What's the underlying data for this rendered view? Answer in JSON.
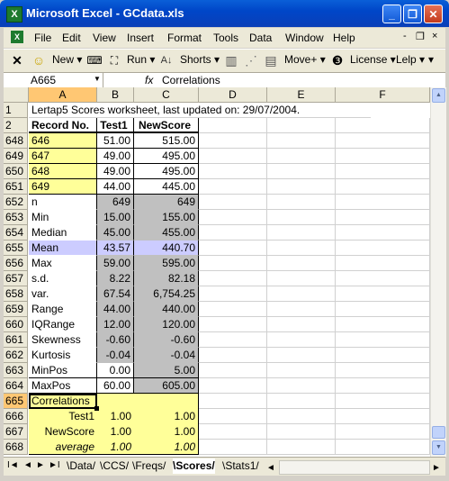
{
  "window": {
    "title": "Microsoft Excel - GCdata.xls",
    "app_icon": "X",
    "buttons": [
      "_",
      "❐",
      "✕"
    ]
  },
  "menubar": {
    "items": [
      "File",
      "Edit",
      "View",
      "Insert",
      "Format",
      "Tools",
      "Data",
      "Window",
      "Help"
    ],
    "controls": [
      "-",
      "❐",
      "×"
    ]
  },
  "toolbar": {
    "new_label": "New",
    "run_label": "Run",
    "shorts_label": "Shorts",
    "movep_label": "Move+",
    "license_label": "License",
    "help_label": "Lelp"
  },
  "formula_bar": {
    "name_box": "A665",
    "fx": "fx",
    "value": "Correlations"
  },
  "columns": [
    "A",
    "B",
    "C",
    "D",
    "E",
    "F"
  ],
  "rows": [
    {
      "num": "1",
      "cells": [
        "Lertap5 Scores worksheet, last updated on: 29/07/2004.",
        "",
        ""
      ],
      "style": "title"
    },
    {
      "num": "2",
      "cells": [
        "Record No.",
        "Test1",
        "NewScore"
      ],
      "style": "header"
    },
    {
      "num": "648",
      "cells": [
        "646",
        "51.00",
        "515.00"
      ],
      "style": "record"
    },
    {
      "num": "649",
      "cells": [
        "647",
        "49.00",
        "495.00"
      ],
      "style": "record"
    },
    {
      "num": "650",
      "cells": [
        "648",
        "49.00",
        "495.00"
      ],
      "style": "record"
    },
    {
      "num": "651",
      "cells": [
        "649",
        "44.00",
        "445.00"
      ],
      "style": "record"
    },
    {
      "num": "652",
      "cells": [
        "n",
        "649",
        "649"
      ],
      "style": "stat"
    },
    {
      "num": "653",
      "cells": [
        "Min",
        "15.00",
        "155.00"
      ],
      "style": "stat"
    },
    {
      "num": "654",
      "cells": [
        "Median",
        "45.00",
        "455.00"
      ],
      "style": "stat"
    },
    {
      "num": "655",
      "cells": [
        "Mean",
        "43.57",
        "440.70"
      ],
      "style": "mean"
    },
    {
      "num": "656",
      "cells": [
        "Max",
        "59.00",
        "595.00"
      ],
      "style": "stat"
    },
    {
      "num": "657",
      "cells": [
        "s.d.",
        "8.22",
        "82.18"
      ],
      "style": "stat"
    },
    {
      "num": "658",
      "cells": [
        "var.",
        "67.54",
        "6,754.25"
      ],
      "style": "stat"
    },
    {
      "num": "659",
      "cells": [
        "Range",
        "44.00",
        "440.00"
      ],
      "style": "stat"
    },
    {
      "num": "660",
      "cells": [
        "IQRange",
        "12.00",
        "120.00"
      ],
      "style": "stat"
    },
    {
      "num": "661",
      "cells": [
        "Skewness",
        "-0.60",
        "-0.60"
      ],
      "style": "stat"
    },
    {
      "num": "662",
      "cells": [
        "Kurtosis",
        "-0.04",
        "-0.04"
      ],
      "style": "stat"
    },
    {
      "num": "663",
      "cells": [
        "MinPos",
        "0.00",
        "5.00"
      ],
      "style": "pos"
    },
    {
      "num": "664",
      "cells": [
        "MaxPos",
        "60.00",
        "605.00"
      ],
      "style": "pos"
    },
    {
      "num": "665",
      "cells": [
        "Correlations",
        "",
        ""
      ],
      "style": "corrhead"
    },
    {
      "num": "666",
      "cells": [
        "Test1",
        "1.00",
        "1.00"
      ],
      "style": "corr"
    },
    {
      "num": "667",
      "cells": [
        "NewScore",
        "1.00",
        "1.00"
      ],
      "style": "corr"
    },
    {
      "num": "668",
      "cells": [
        "average",
        "1.00",
        "1.00"
      ],
      "style": "corravg"
    }
  ],
  "sheet_tabs": [
    "Data",
    "CCS",
    "Freqs",
    "Scores",
    "Stats1"
  ],
  "active_tab": "Scores",
  "tab_nav": [
    "I◄",
    "◄",
    "►",
    "►I"
  ],
  "colors": {
    "titlebar": "#0046c8",
    "yellow": "#ffff99",
    "gray": "#c0c0c0",
    "mean_highlight": "#ccccff",
    "selected_header": "#ffc773"
  }
}
